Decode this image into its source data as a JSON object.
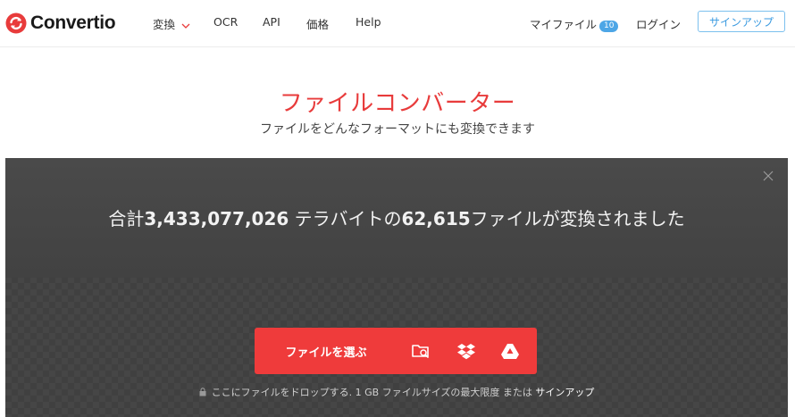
{
  "brand": {
    "name": "Convertio",
    "color": "#e83b3b"
  },
  "nav": {
    "convert": "変換",
    "ocr": "OCR",
    "api": "API",
    "price": "価格",
    "help": "Help",
    "my_files": "マイファイル",
    "my_files_count": "10",
    "login": "ログイン",
    "signup": "サインアップ"
  },
  "hero": {
    "title": "ファイルコンバーター",
    "subtitle": "ファイルをどんなフォーマットにも変換できます"
  },
  "stats": {
    "prefix": "合計",
    "terabytes": "3,433,077,026",
    "middle": " テラバイトの",
    "files": "62,615",
    "suffix": "ファイルが変換されました"
  },
  "upload": {
    "choose_label": "ファイルを選ぶ",
    "sources": [
      "folder-search-icon",
      "dropbox-icon",
      "google-drive-icon"
    ],
    "note_text": "ここにファイルをドロップする. 1 GB ファイルサイズの最大限度 または ",
    "note_link": "サインアップ"
  },
  "colors": {
    "accent_red": "#ef3b3b",
    "link_blue": "#3a9ae0",
    "panel_dark": "#404040"
  }
}
